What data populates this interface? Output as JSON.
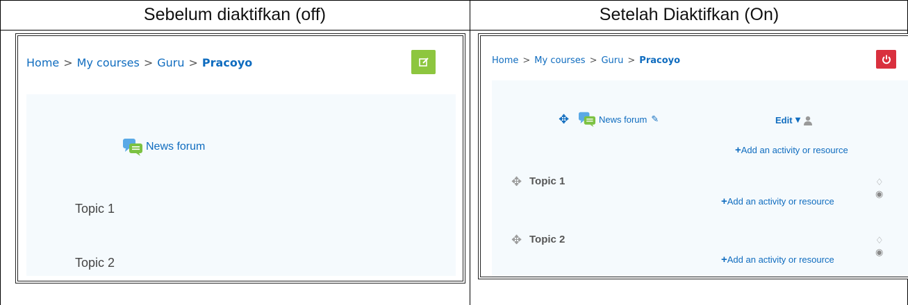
{
  "headers": {
    "left": "Sebelum diaktifkan (off)",
    "right": "Setelah Diaktifkan (On)"
  },
  "left_panel": {
    "breadcrumb": [
      "Home",
      "My courses",
      "Guru",
      "Pracoyo"
    ],
    "separator": ">",
    "edit_button_color": "#8dc63f",
    "forum_label": "News forum",
    "topics": [
      "Topic 1",
      "Topic 2"
    ]
  },
  "right_panel": {
    "breadcrumb": [
      "Home",
      "My courses",
      "Guru",
      "Pracoyo"
    ],
    "separator": ">",
    "power_button_color": "#d9303e",
    "forum_label": "News forum",
    "edit_menu_label": "Edit",
    "add_activity_label": "Add an activity or resource",
    "topics": [
      "Topic 1",
      "Topic 2"
    ]
  },
  "colors": {
    "link": "#0f6cbf",
    "content_bg": "#f5fafd"
  }
}
